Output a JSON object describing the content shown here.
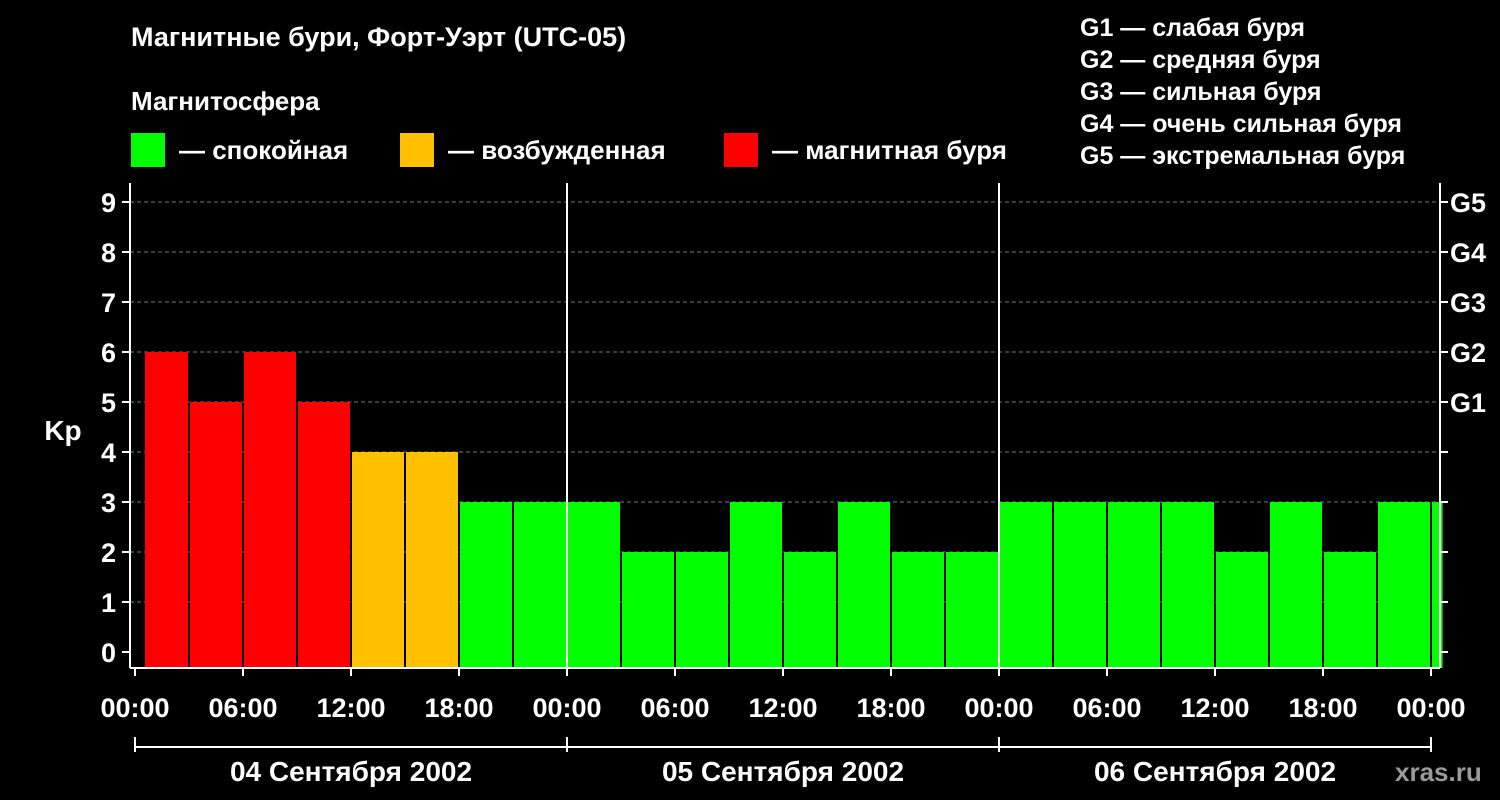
{
  "title": "Магнитные бури, Форт-Уэрт (UTC-05)",
  "subtitle": "Магнитосфера",
  "legend": [
    {
      "label": "— спокойная",
      "color": "#00ff00"
    },
    {
      "label": "— возбужденная",
      "color": "#ffc000"
    },
    {
      "label": "— магнитная буря",
      "color": "#ff0000"
    }
  ],
  "storm_scale": [
    "G1 — слабая буря",
    "G2 — средняя буря",
    "G3 — сильная буря",
    "G4 — очень сильная буря",
    "G5 — экстремальная буря"
  ],
  "watermark": "xras.ru",
  "chart_data": {
    "type": "bar",
    "ylabel": "Kp",
    "ylim": [
      0,
      9
    ],
    "yticks": [
      "0",
      "1",
      "2",
      "3",
      "4",
      "5",
      "6",
      "7",
      "8",
      "9"
    ],
    "right_ticks": [
      {
        "value": 5,
        "label": "G1"
      },
      {
        "value": 6,
        "label": "G2"
      },
      {
        "value": 7,
        "label": "G3"
      },
      {
        "value": 8,
        "label": "G4"
      },
      {
        "value": 9,
        "label": "G5"
      }
    ],
    "grid": true,
    "x_tick_labels": [
      "00:00",
      "06:00",
      "12:00",
      "18:00",
      "00:00",
      "06:00",
      "12:00",
      "18:00",
      "00:00",
      "06:00",
      "12:00",
      "18:00",
      "00:00"
    ],
    "day_labels": [
      "04 Сентября 2002",
      "05 Сентября 2002",
      "06 Сентября 2002"
    ],
    "bars": [
      {
        "start_hour": 0.5,
        "end_hour": 3,
        "value": 6,
        "level": "storm"
      },
      {
        "start_hour": 3,
        "end_hour": 6,
        "value": 5,
        "level": "storm"
      },
      {
        "start_hour": 6,
        "end_hour": 9,
        "value": 6,
        "level": "storm"
      },
      {
        "start_hour": 9,
        "end_hour": 12,
        "value": 5,
        "level": "storm"
      },
      {
        "start_hour": 12,
        "end_hour": 15,
        "value": 4,
        "level": "active"
      },
      {
        "start_hour": 15,
        "end_hour": 18,
        "value": 4,
        "level": "active"
      },
      {
        "start_hour": 18,
        "end_hour": 21,
        "value": 3,
        "level": "quiet"
      },
      {
        "start_hour": 21,
        "end_hour": 24,
        "value": 3,
        "level": "quiet"
      },
      {
        "start_hour": 24,
        "end_hour": 27,
        "value": 3,
        "level": "quiet"
      },
      {
        "start_hour": 27,
        "end_hour": 30,
        "value": 2,
        "level": "quiet"
      },
      {
        "start_hour": 30,
        "end_hour": 33,
        "value": 2,
        "level": "quiet"
      },
      {
        "start_hour": 33,
        "end_hour": 36,
        "value": 3,
        "level": "quiet"
      },
      {
        "start_hour": 36,
        "end_hour": 39,
        "value": 2,
        "level": "quiet"
      },
      {
        "start_hour": 39,
        "end_hour": 42,
        "value": 3,
        "level": "quiet"
      },
      {
        "start_hour": 42,
        "end_hour": 45,
        "value": 2,
        "level": "quiet"
      },
      {
        "start_hour": 45,
        "end_hour": 48,
        "value": 2,
        "level": "quiet"
      },
      {
        "start_hour": 48,
        "end_hour": 51,
        "value": 3,
        "level": "quiet"
      },
      {
        "start_hour": 51,
        "end_hour": 54,
        "value": 3,
        "level": "quiet"
      },
      {
        "start_hour": 54,
        "end_hour": 57,
        "value": 3,
        "level": "quiet"
      },
      {
        "start_hour": 57,
        "end_hour": 60,
        "value": 3,
        "level": "quiet"
      },
      {
        "start_hour": 60,
        "end_hour": 63,
        "value": 2,
        "level": "quiet"
      },
      {
        "start_hour": 63,
        "end_hour": 66,
        "value": 3,
        "level": "quiet"
      },
      {
        "start_hour": 66,
        "end_hour": 69,
        "value": 2,
        "level": "quiet"
      },
      {
        "start_hour": 69,
        "end_hour": 72,
        "value": 3,
        "level": "quiet"
      },
      {
        "start_hour": 72,
        "end_hour": 72.7,
        "value": 3,
        "level": "quiet"
      }
    ],
    "level_colors": {
      "quiet": "#00ff00",
      "active": "#ffc000",
      "storm": "#ff0000"
    }
  }
}
